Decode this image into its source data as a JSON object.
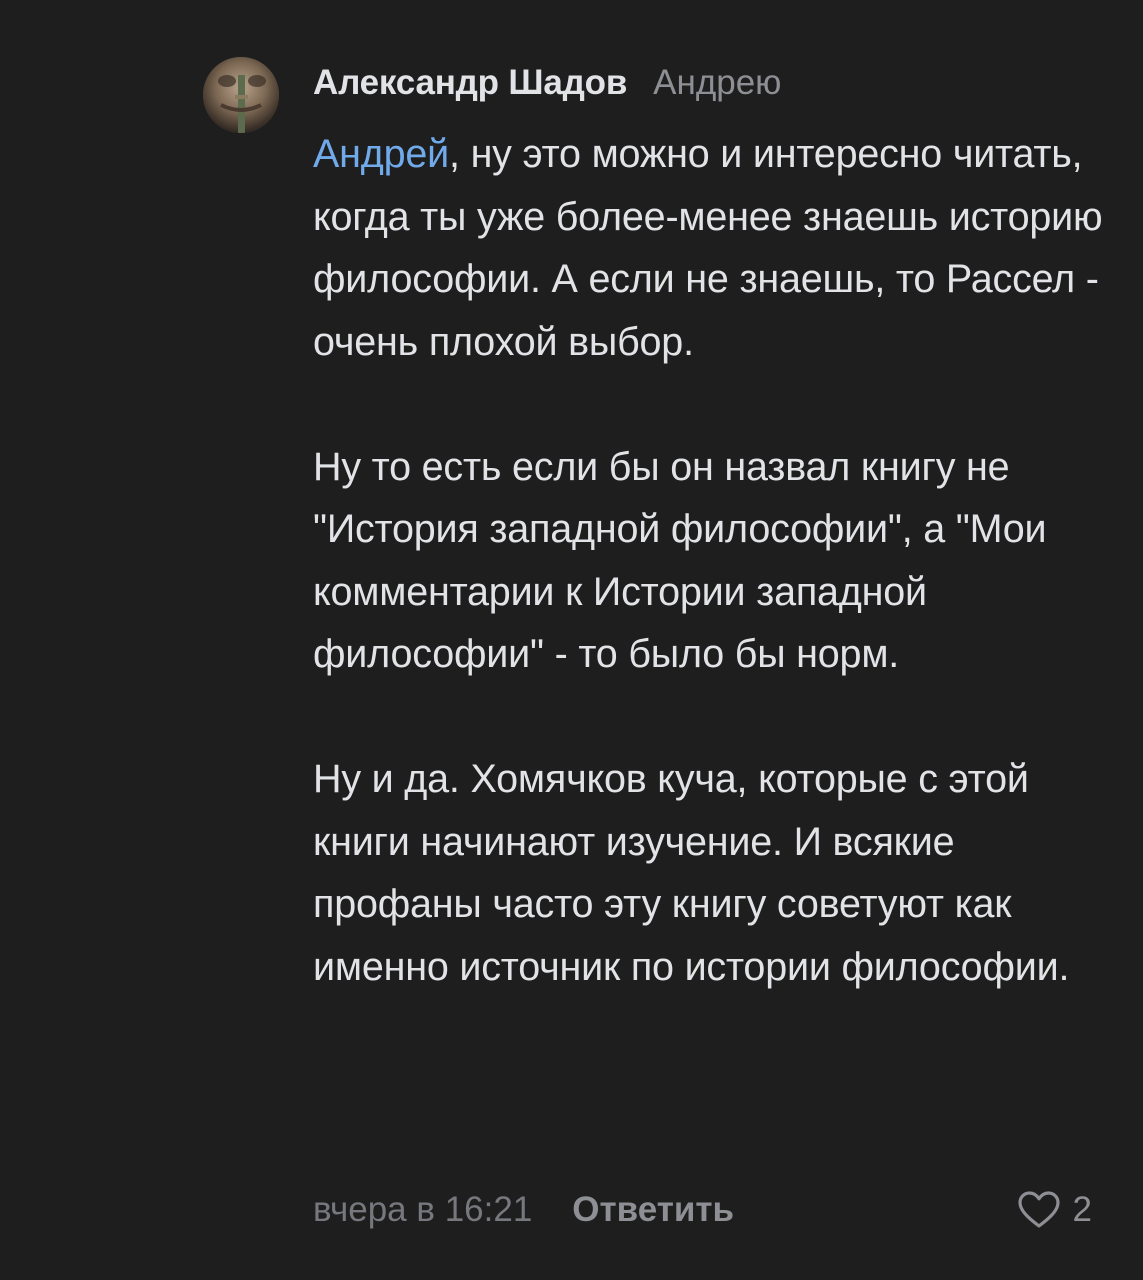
{
  "comment": {
    "author": "Александр Шадов",
    "reply_to": "Андрею",
    "mention": "Андрей",
    "paragraph1_after_mention": ", ну это можно и интересно читать, когда ты уже более-менее знаешь историю философии. А если не знаешь, то Рассел - очень плохой выбор.",
    "paragraph2": "Ну то есть если бы он назвал книгу не \"История западной философии\", а \"Мои комментарии к Истории западной философии\" - то было бы норм.",
    "paragraph3": "Ну и да. Хомячков куча, которые с этой книги начинают изучение. И всякие профаны часто эту книгу советуют как именно источник по истории философии.",
    "timestamp": "вчера в 16:21",
    "reply_label": "Ответить",
    "like_count": "2",
    "icons": {
      "avatar": "user-avatar",
      "like": "heart-outline-icon"
    },
    "colors": {
      "background": "#1e1e1e",
      "text": "#e2e3e6",
      "mention": "#71aaeb",
      "secondary": "#8d8f94"
    }
  }
}
